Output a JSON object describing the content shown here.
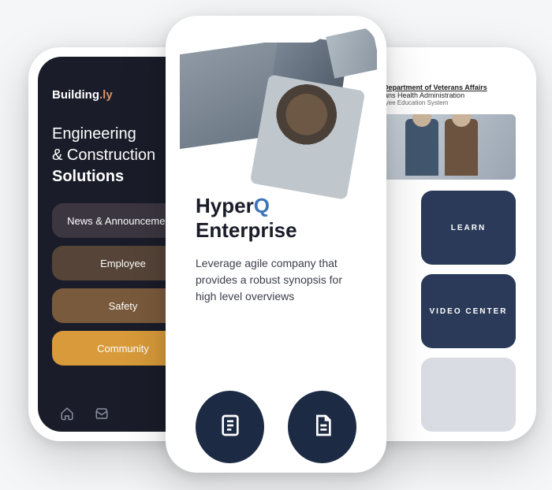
{
  "left": {
    "brand_prefix": "Building",
    "brand_suffix": ".ly",
    "hero_line1": "Engineering",
    "hero_line2": "& Construction",
    "hero_line3": "Solutions",
    "pills": {
      "a": "News & Announcements",
      "b": "Employee",
      "c": "Safety",
      "d": "Community"
    }
  },
  "center": {
    "title_prefix": "Hyper",
    "title_accent": "Q",
    "subtitle": "Enterprise",
    "description": "Leverage agile company that provides a robust synopsis for high level overviews"
  },
  "right": {
    "header_line1": "U.S. Department of Veterans Affairs",
    "header_line2": "Veterans Health Administration",
    "header_line3": "Employee Education System",
    "tiles": {
      "learn": "LEARN",
      "video": "VIDEO CENTER"
    }
  }
}
